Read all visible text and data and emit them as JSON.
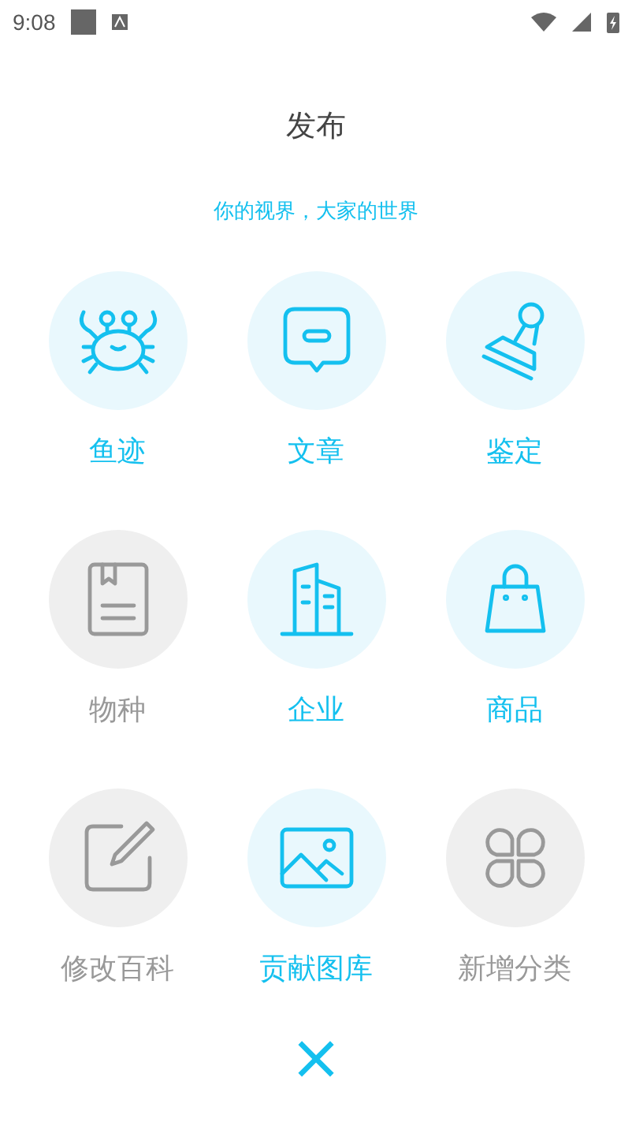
{
  "status_bar": {
    "time": "9:08"
  },
  "title": "发布",
  "subtitle": "你的视界，大家的世界",
  "items": [
    {
      "kind": "crab",
      "label": "鱼迹",
      "disabled": false
    },
    {
      "kind": "chat",
      "label": "文章",
      "disabled": false
    },
    {
      "kind": "stamp",
      "label": "鉴定",
      "disabled": false
    },
    {
      "kind": "book",
      "label": "物种",
      "disabled": true
    },
    {
      "kind": "building",
      "label": "企业",
      "disabled": false
    },
    {
      "kind": "bag",
      "label": "商品",
      "disabled": false
    },
    {
      "kind": "edit",
      "label": "修改百科",
      "disabled": true
    },
    {
      "kind": "image",
      "label": "贡献图库",
      "disabled": false
    },
    {
      "kind": "clover",
      "label": "新增分类",
      "disabled": true
    }
  ],
  "close": "×"
}
